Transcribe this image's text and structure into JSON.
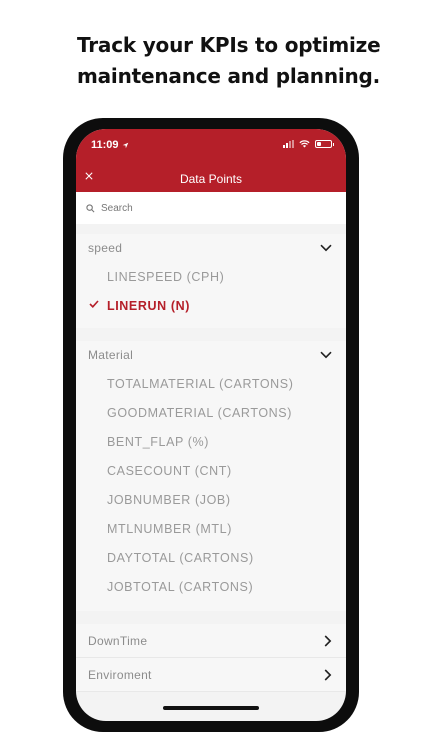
{
  "headline": {
    "line1": "Track your KPIs to optimize",
    "line2": "maintenance and planning."
  },
  "status_bar": {
    "time": "11:09"
  },
  "appbar": {
    "title": "Data Points"
  },
  "search": {
    "placeholder": "Search"
  },
  "sections": [
    {
      "title": "speed",
      "items": [
        {
          "label": "LINESPEED (CPH)",
          "selected": false
        },
        {
          "label": "LINERUN (N)",
          "selected": true
        }
      ]
    },
    {
      "title": "Material",
      "items": [
        {
          "label": "TOTALMATERIAL (CARTONS)"
        },
        {
          "label": "GOODMATERIAL (CARTONS)"
        },
        {
          "label": "BENT_FLAP (%)"
        },
        {
          "label": "CASECOUNT (CNT)"
        },
        {
          "label": "JOBNUMBER (JOB)"
        },
        {
          "label": "MTLNUMBER (MTL)"
        },
        {
          "label": "DAYTOTAL (CARTONS)"
        },
        {
          "label": "JOBTOTAL (CARTONS)"
        }
      ]
    }
  ],
  "collapsed_sections": [
    {
      "title": "DownTime"
    },
    {
      "title": "Enviroment"
    }
  ],
  "colors": {
    "accent": "#b51f29",
    "text_muted": "#9a9a9a"
  },
  "icons": [
    "close-icon",
    "search-icon",
    "chevron-down-icon",
    "chevron-right-icon",
    "checkmark-icon",
    "location-arrow-icon",
    "signal-icon",
    "wifi-icon",
    "battery-icon"
  ]
}
